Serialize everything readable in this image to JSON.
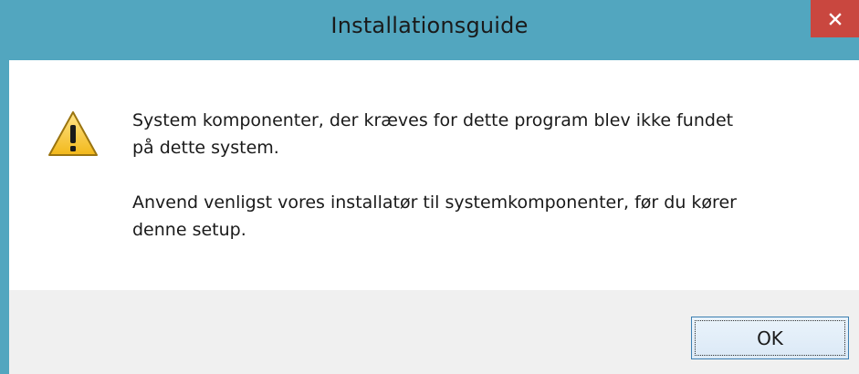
{
  "window": {
    "title": "Installationsguide"
  },
  "titlebar_buttons": {
    "close_icon": "close-icon",
    "close_color": "#c9473f"
  },
  "dialog": {
    "icon": "warning-icon",
    "message_line1": "System komponenter, der kræves for dette program blev ikke fundet\npå dette system.",
    "message_line2": "Anvend venligst vores installatør til systemkomponenter, før du kører\ndenne setup."
  },
  "buttons": {
    "ok_label": "OK"
  },
  "colors": {
    "titlebar": "#52a6bf",
    "footer": "#f0f0f0",
    "ok_border": "#3c7fb1"
  }
}
